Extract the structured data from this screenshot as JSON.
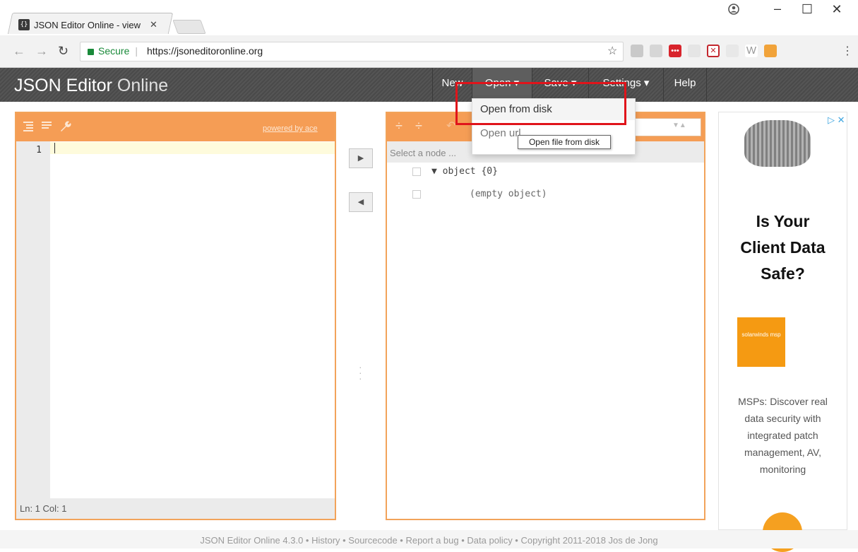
{
  "browser": {
    "tab_title": "JSON Editor Online - view",
    "favicon": "{}",
    "secure_label": "Secure",
    "url": "https://jsoneditoronline.org",
    "window_controls": [
      "user-icon",
      "minimize-icon",
      "maximize-icon",
      "close-icon"
    ]
  },
  "app": {
    "brand_bold": "JSON Editor",
    "brand_light": "Online",
    "menu": {
      "new": "New",
      "open": "Open ▾",
      "save": "Save ▾",
      "settings": "Settings ▾",
      "help": "Help"
    },
    "open_menu": {
      "from_disk": "Open from disk",
      "url": "Open url"
    },
    "tooltip": "Open file from disk"
  },
  "code_editor": {
    "powered_by": "powered by ace",
    "line_number": "1",
    "status": "Ln: 1   Col: 1"
  },
  "tree_editor": {
    "nav_placeholder": "Select a node ...",
    "root": "object {0}",
    "empty": "(empty object)"
  },
  "ad": {
    "headline_1": "Is Your",
    "headline_2": "Client Data",
    "headline_3": "Safe?",
    "logo_text": "solarwinds msp",
    "body": "MSPs: Discover real data security with integrated patch management, AV, monitoring"
  },
  "footer": "JSON Editor Online 4.3.0 • History • Sourcecode • Report a bug • Data policy • Copyright 2011-2018 Jos de Jong",
  "colors": {
    "accent": "#f59d55",
    "header": "#4a4a4a",
    "highlight_box": "#e0141b"
  }
}
